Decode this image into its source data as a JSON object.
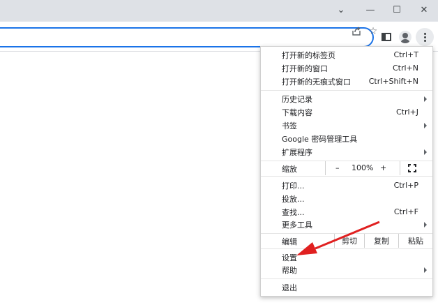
{
  "window": {
    "tab_search_glyph": "⌄",
    "minimize_glyph": "—",
    "maximize_glyph": "☐",
    "close_glyph": "✕"
  },
  "toolbar": {
    "share_icon": "share-icon",
    "star_glyph": "☆"
  },
  "menu": {
    "new_tab": {
      "label": "打开新的标签页",
      "shortcut": "Ctrl+T"
    },
    "new_window": {
      "label": "打开新的窗口",
      "shortcut": "Ctrl+N"
    },
    "new_incognito": {
      "label": "打开新的无痕式窗口",
      "shortcut": "Ctrl+Shift+N"
    },
    "history": {
      "label": "历史记录"
    },
    "downloads": {
      "label": "下载内容",
      "shortcut": "Ctrl+J"
    },
    "bookmarks": {
      "label": "书签"
    },
    "password_manager": {
      "label": "Google 密码管理工具"
    },
    "extensions": {
      "label": "扩展程序"
    },
    "zoom": {
      "label": "缩放",
      "minus": "–",
      "value": "100%",
      "plus": "+"
    },
    "print": {
      "label": "打印...",
      "shortcut": "Ctrl+P"
    },
    "cast": {
      "label": "投放..."
    },
    "find": {
      "label": "查找...",
      "shortcut": "Ctrl+F"
    },
    "more_tools": {
      "label": "更多工具"
    },
    "edit": {
      "label": "编辑",
      "cut": "剪切",
      "copy": "复制",
      "paste": "粘贴"
    },
    "settings": {
      "label": "设置"
    },
    "help": {
      "label": "帮助"
    },
    "exit": {
      "label": "退出"
    }
  },
  "annotation": {
    "color": "#e02020"
  }
}
